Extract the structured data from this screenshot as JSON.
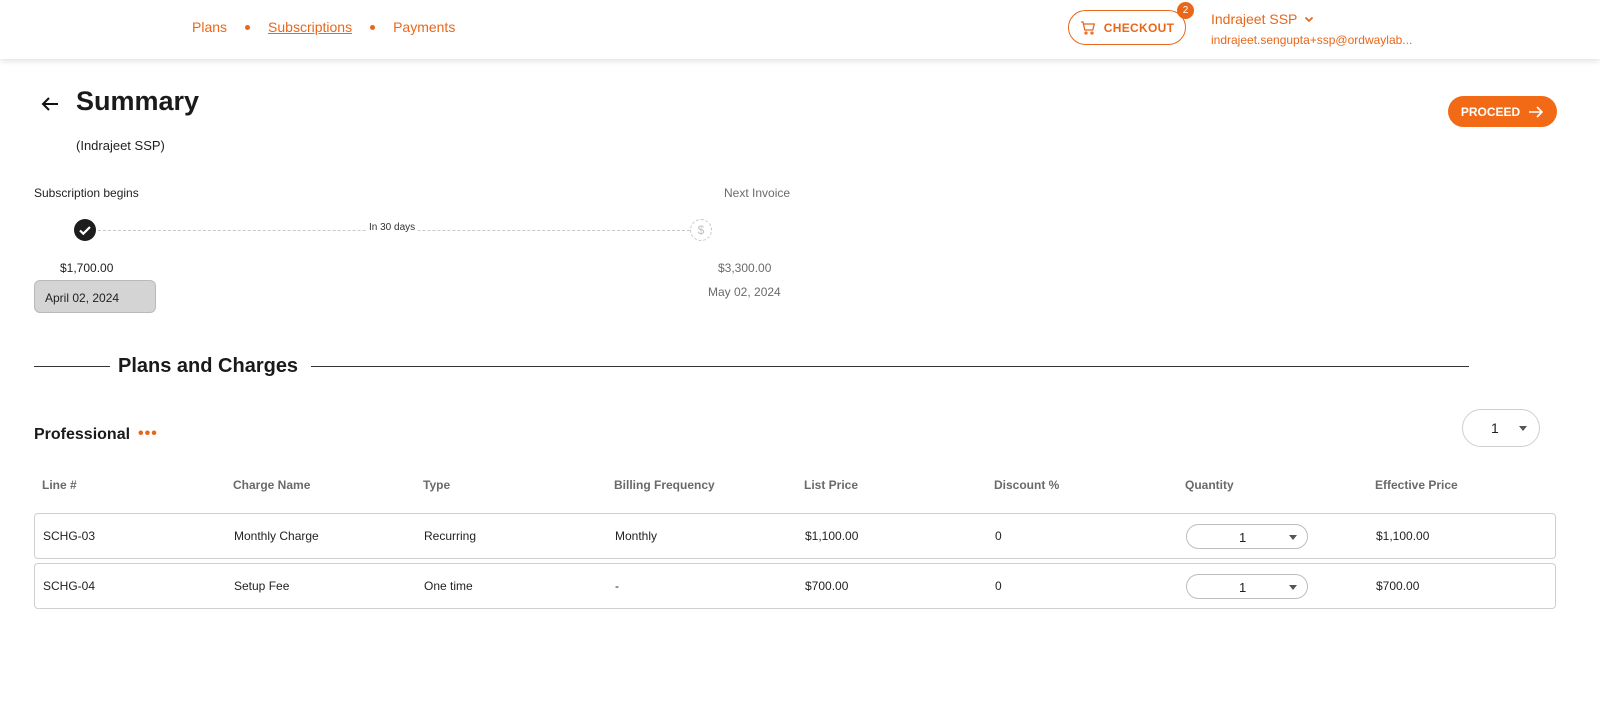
{
  "nav": {
    "items": [
      {
        "label": "Plans",
        "active": false
      },
      {
        "label": "Subscriptions",
        "active": true
      },
      {
        "label": "Payments",
        "active": false
      }
    ]
  },
  "header": {
    "checkout_label": "CHECKOUT",
    "cart_count": "2",
    "user_name": "Indrajeet SSP",
    "user_email": "indrajeet.sengupta+ssp@ordwaylab..."
  },
  "page": {
    "title": "Summary",
    "subtitle": "(Indrajeet SSP)",
    "proceed_label": "PROCEED"
  },
  "timeline": {
    "begin_label": "Subscription begins",
    "next_label": "Next Invoice",
    "interval": "In 30 days",
    "begin_amount": "$1,700.00",
    "begin_date": "April 02, 2024",
    "next_amount": "$3,300.00",
    "next_date": "May 02, 2024",
    "next_icon": "$"
  },
  "section": {
    "title": "Plans and Charges"
  },
  "plan": {
    "name": "Professional",
    "more": "•••",
    "selected_qty": "1"
  },
  "table": {
    "headers": [
      "Line #",
      "Charge Name",
      "Type",
      "Billing Frequency",
      "List Price",
      "Discount %",
      "Quantity",
      "Effective Price"
    ],
    "rows": [
      {
        "line": "SCHG-03",
        "charge": "Monthly Charge",
        "type": "Recurring",
        "frequency": "Monthly",
        "list_price": "$1,100.00",
        "discount": "0",
        "quantity": "1",
        "effective": "$1,100.00"
      },
      {
        "line": "SCHG-04",
        "charge": "Setup Fee",
        "type": "One time",
        "frequency": "-",
        "list_price": "$700.00",
        "discount": "0",
        "quantity": "1",
        "effective": "$700.00"
      }
    ]
  },
  "colors": {
    "accent": "#f26a16",
    "text_muted": "#6b6b6b"
  }
}
